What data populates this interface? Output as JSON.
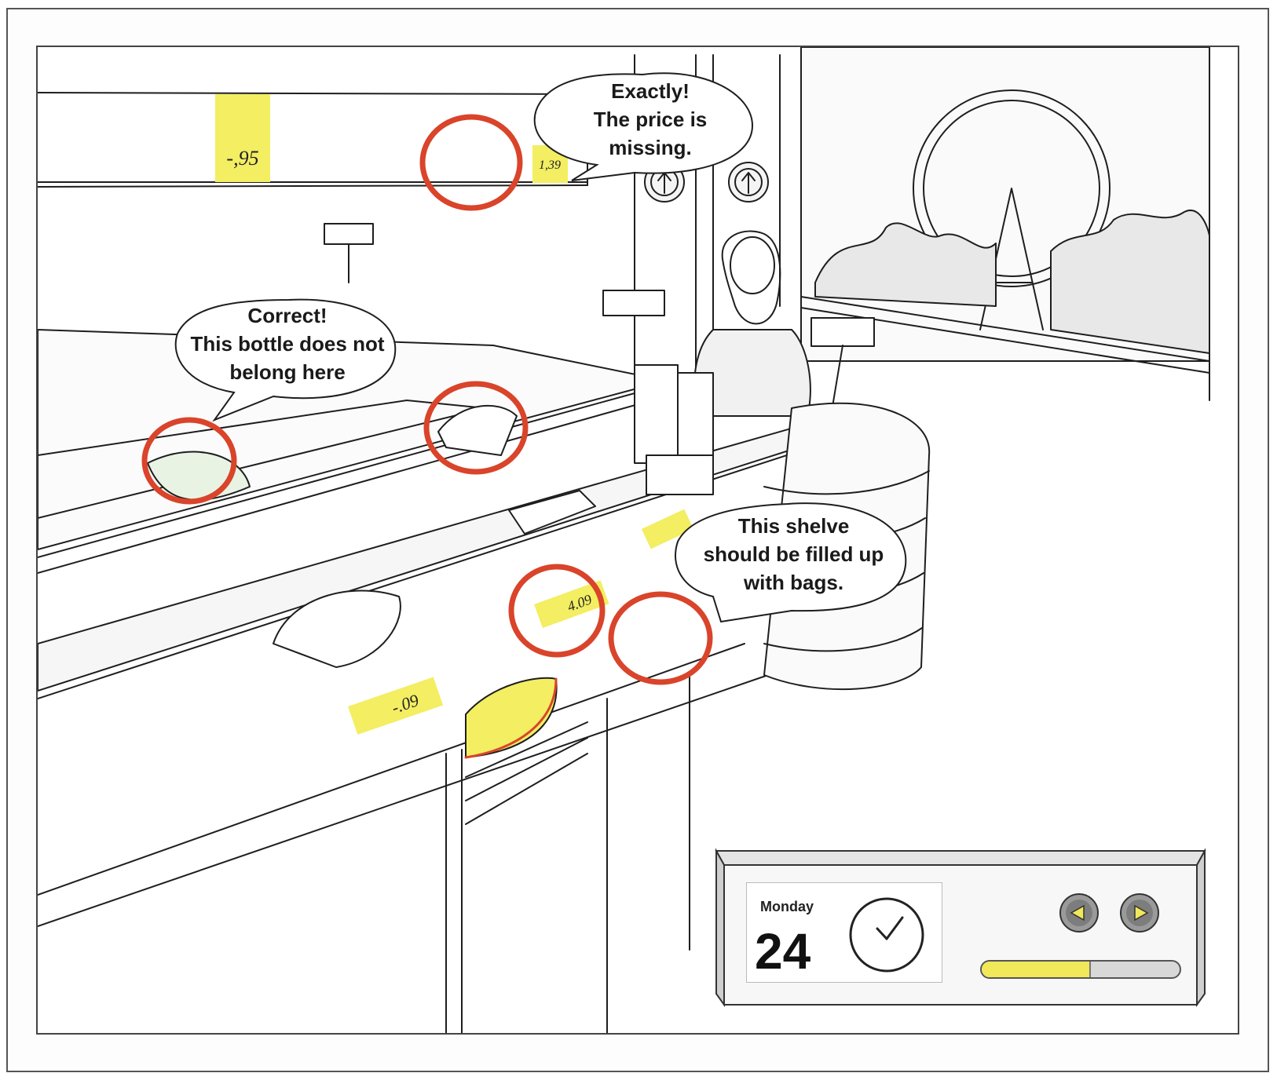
{
  "feedback_bubbles": {
    "price_missing": [
      "Exactly!",
      "The price is",
      "missing."
    ],
    "bottle": [
      "Correct!",
      "This bottle does not",
      "belong here"
    ],
    "shelf_bags": [
      "This shelve",
      "should be filled up",
      "with bags."
    ]
  },
  "price_tags": {
    "top_shelf_left": "-,95",
    "top_shelf_right": "1,39",
    "counter_front": "-.09",
    "counter_middle": "4.09"
  },
  "status_panel": {
    "day_name": "Monday",
    "day_number": "24",
    "progress": 0.55,
    "icons": {
      "clock": "clock-icon",
      "previous": "previous-arrow-icon",
      "next": "next-arrow-icon"
    }
  },
  "colors": {
    "highlight_ring": "#d9442a",
    "price_tag": "#f3ee62",
    "progress_fill": "#f1e85a",
    "ink": "#1e1e1e"
  }
}
